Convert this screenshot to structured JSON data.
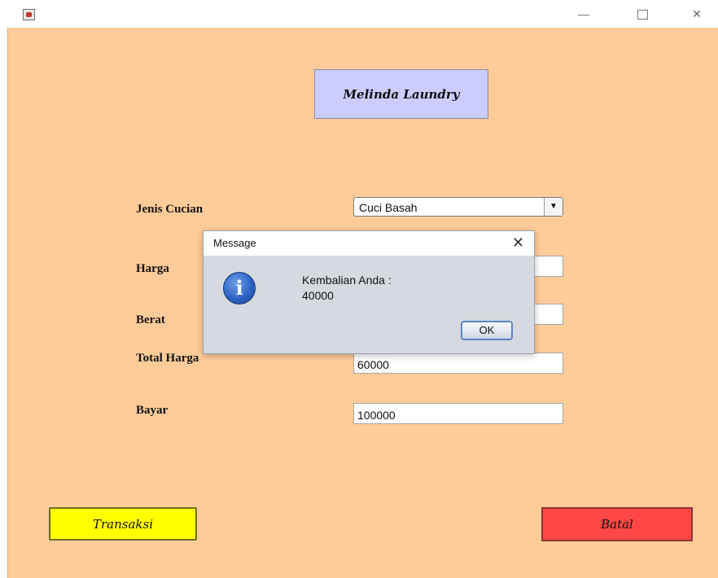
{
  "window": {
    "close_glyph": "✕",
    "icon": "java-app-icon"
  },
  "header": {
    "title": "Melinda Laundry"
  },
  "form": {
    "jenis_cucian_label": "Jenis Cucian",
    "jenis_cucian_value": "Cuci Basah",
    "harga_label": "Harga",
    "harga_value": "",
    "berat_label": "Berat",
    "berat_value": "",
    "total_harga_label": "Total Harga",
    "total_harga_value": "60000",
    "bayar_label": "Bayar",
    "bayar_value": "100000"
  },
  "buttons": {
    "transaksi": "Transaksi",
    "batal": "Batal"
  },
  "dialog": {
    "title": "Message",
    "close_glyph": "✕",
    "icon": "info-icon",
    "icon_glyph": "i",
    "message_line1": "Kembalian Anda :",
    "message_line2": "40000",
    "ok_label": "OK"
  },
  "colors": {
    "background": "#ffcc99",
    "header_box": "#ccccff",
    "transaksi_button": "#ffff00",
    "batal_button": "#ff4747",
    "dialog_body": "#d6d9df"
  }
}
